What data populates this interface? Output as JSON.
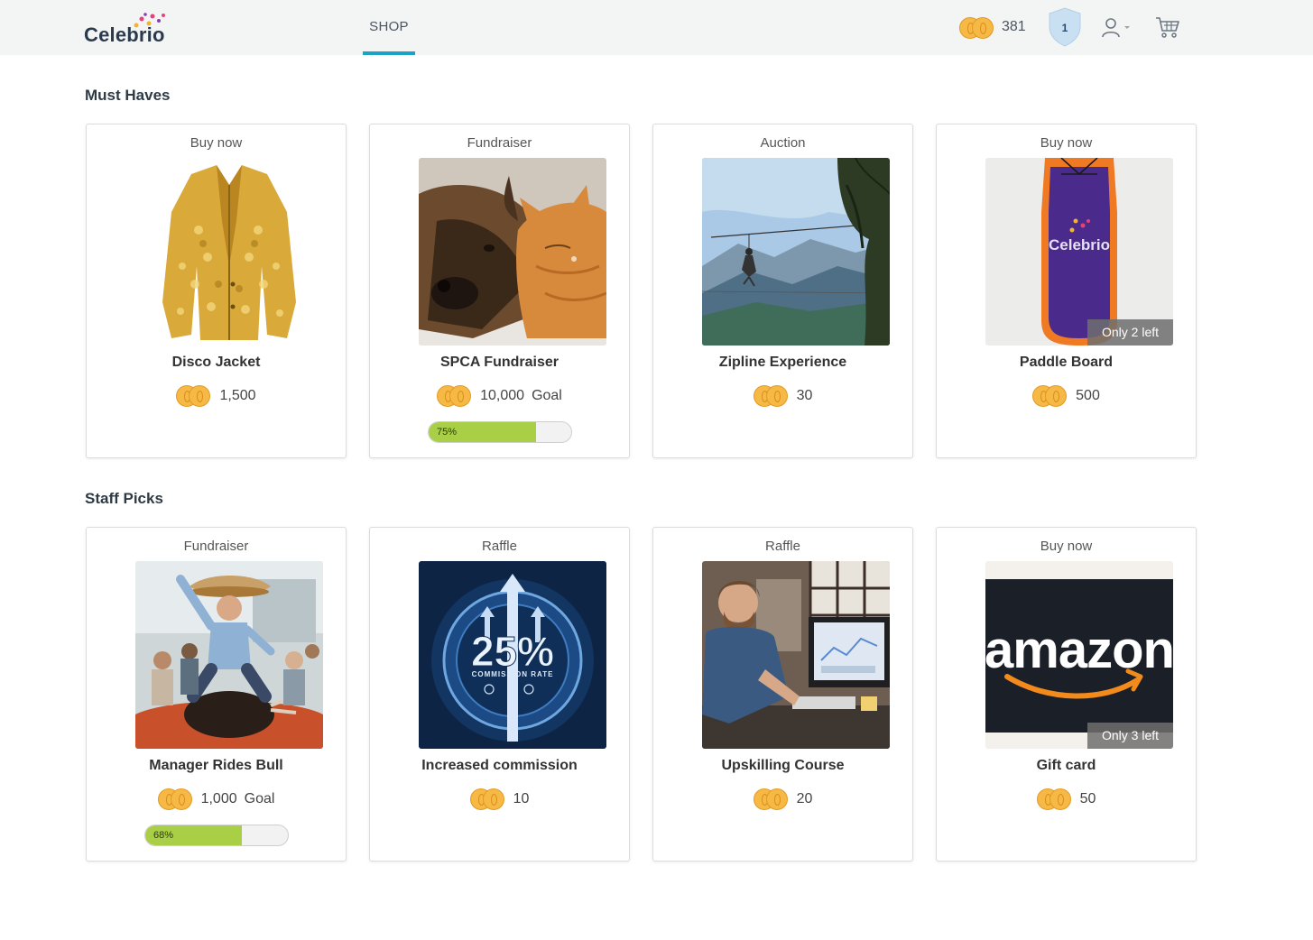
{
  "header": {
    "logo_text": "Celebrio",
    "nav_shop": "SHOP",
    "balance": "381",
    "level": "1"
  },
  "sections": [
    {
      "title": "Must Haves",
      "cards": [
        {
          "type": "Buy now",
          "name": "Disco Jacket",
          "price": "1,500",
          "goal": "",
          "progress": null,
          "progress_label": "",
          "stock": "",
          "image": "gold-sequin-jacket"
        },
        {
          "type": "Fundraiser",
          "name": "SPCA Fundraiser",
          "price": "10,000",
          "goal": "Goal",
          "progress": 0.75,
          "progress_label": "75%",
          "stock": "",
          "image": "dog-and-cat"
        },
        {
          "type": "Auction",
          "name": "Zipline Experience",
          "price": "30",
          "goal": "",
          "progress": null,
          "progress_label": "",
          "stock": "",
          "image": "zipline-mountains"
        },
        {
          "type": "Buy now",
          "name": "Paddle Board",
          "price": "500",
          "goal": "",
          "progress": null,
          "progress_label": "",
          "stock": "Only 2 left",
          "image": "celebrio-paddle-board",
          "image_text": "Celebrio"
        }
      ]
    },
    {
      "title": "Staff Picks",
      "cards": [
        {
          "type": "Fundraiser",
          "name": "Manager Rides Bull",
          "price": "1,000",
          "goal": "Goal",
          "progress": 0.68,
          "progress_label": "68%",
          "stock": "",
          "image": "man-riding-mechanical-bull"
        },
        {
          "type": "Raffle",
          "name": "Increased commission",
          "price": "10",
          "goal": "",
          "progress": null,
          "progress_label": "",
          "stock": "",
          "image": "commission-rate-badge",
          "image_text": "25%",
          "image_subtext": "COMMISSION RATE"
        },
        {
          "type": "Raffle",
          "name": "Upskilling Course",
          "price": "20",
          "goal": "",
          "progress": null,
          "progress_label": "",
          "stock": "",
          "image": "man-at-computer"
        },
        {
          "type": "Buy now",
          "name": "Gift card",
          "price": "50",
          "goal": "",
          "progress": null,
          "progress_label": "",
          "stock": "Only 3 left",
          "image": "amazon-logo",
          "image_text": "amazon"
        }
      ]
    }
  ],
  "colors": {
    "accent": "#1ba3c6",
    "progress": "#a8cf45",
    "coin": "#f6b945",
    "header_bg": "#f3f5f5"
  }
}
